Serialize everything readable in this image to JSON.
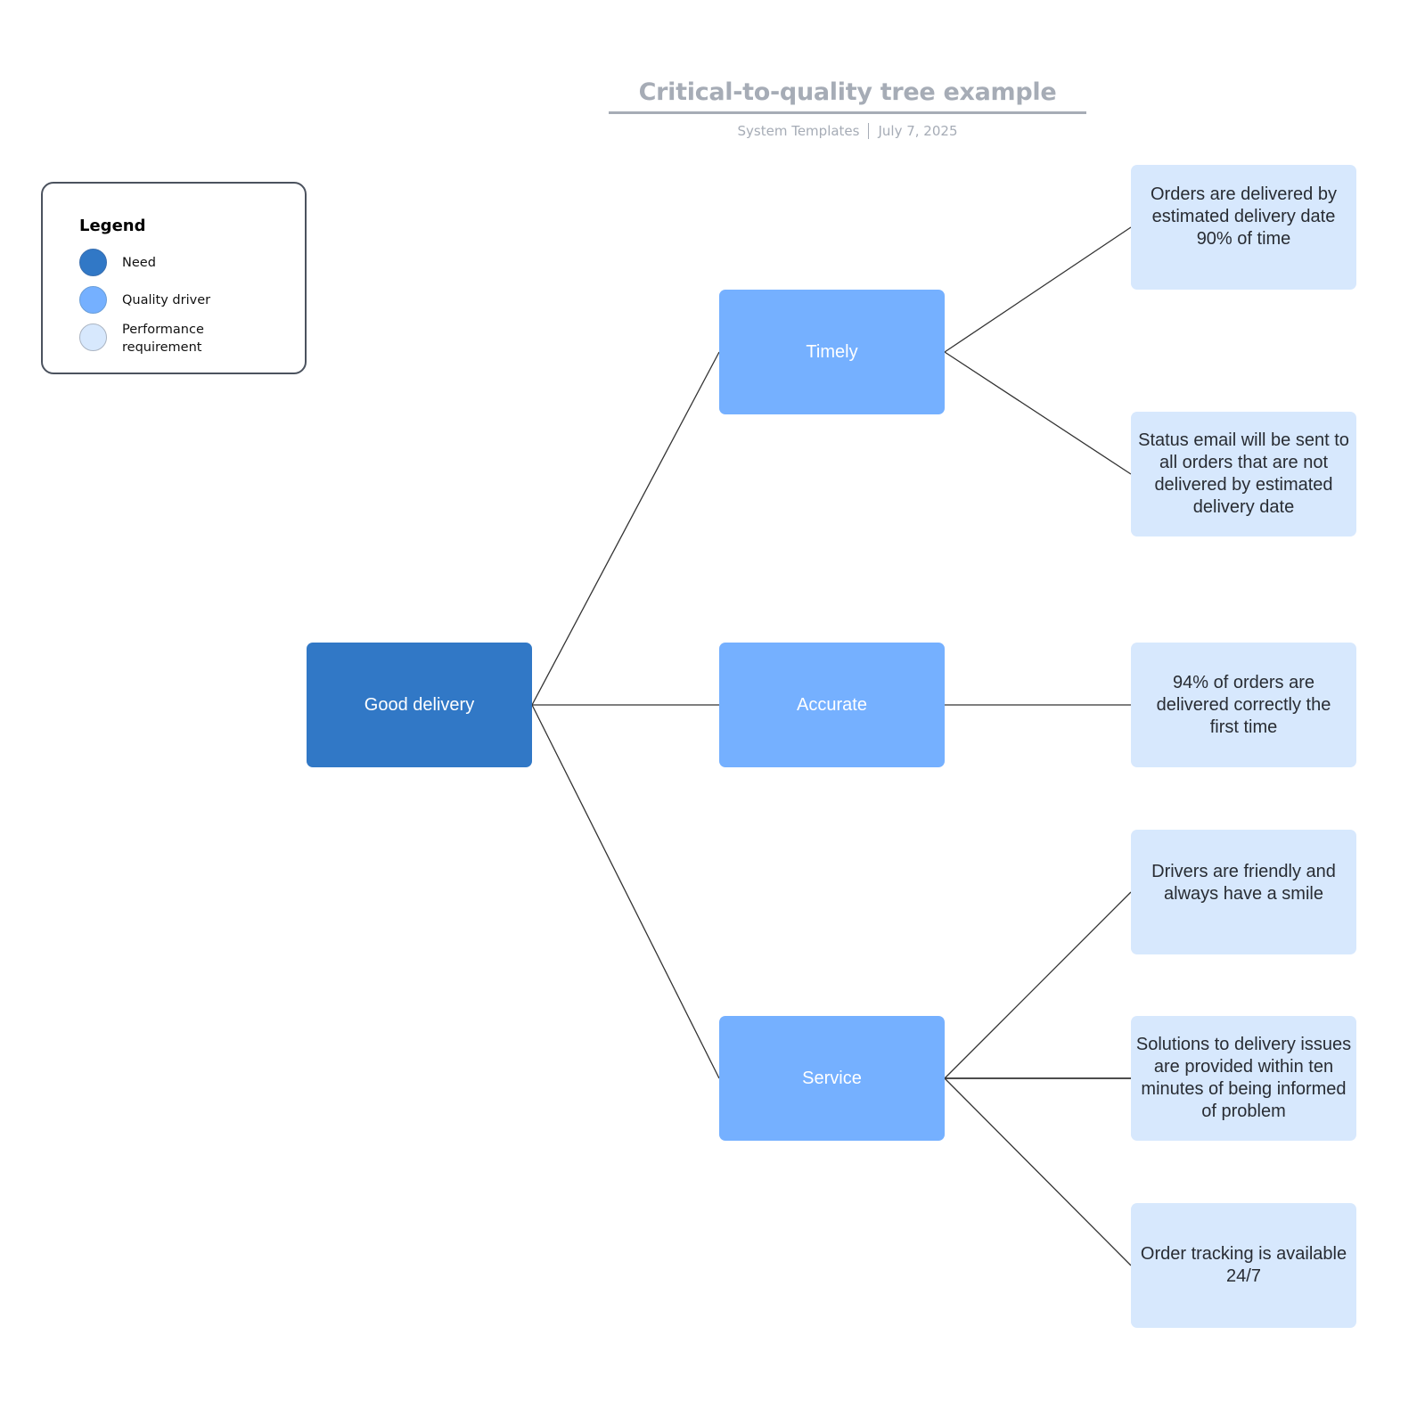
{
  "header": {
    "title": "Critical-to-quality tree example",
    "author": "System Templates",
    "date": "July 7, 2025"
  },
  "legend": {
    "title": "Legend",
    "items": [
      {
        "label": "Need",
        "color": "#3178c6"
      },
      {
        "label": "Quality driver",
        "color": "#75b0ff"
      },
      {
        "label": "Performance requirement",
        "color": "#d7e8fd"
      }
    ]
  },
  "colors": {
    "need": "#3178c6",
    "quality_driver": "#75b0ff",
    "performance_requirement": "#d7e8fd",
    "connector": "#333333"
  },
  "tree": {
    "need": {
      "label": "Good delivery"
    },
    "drivers": [
      {
        "label": "Timely",
        "requirements": [
          "Orders are delivered by estimated delivery date 90% of time",
          "Status email will be sent to all orders that are not delivered by estimated delivery date"
        ]
      },
      {
        "label": "Accurate",
        "requirements": [
          "94% of orders are delivered correctly the first time"
        ]
      },
      {
        "label": "Service",
        "requirements": [
          "Drivers are friendly and always have a smile",
          "Solutions to delivery issues are provided within ten minutes of being informed of problem",
          "Order tracking is available 24/7"
        ]
      }
    ]
  }
}
